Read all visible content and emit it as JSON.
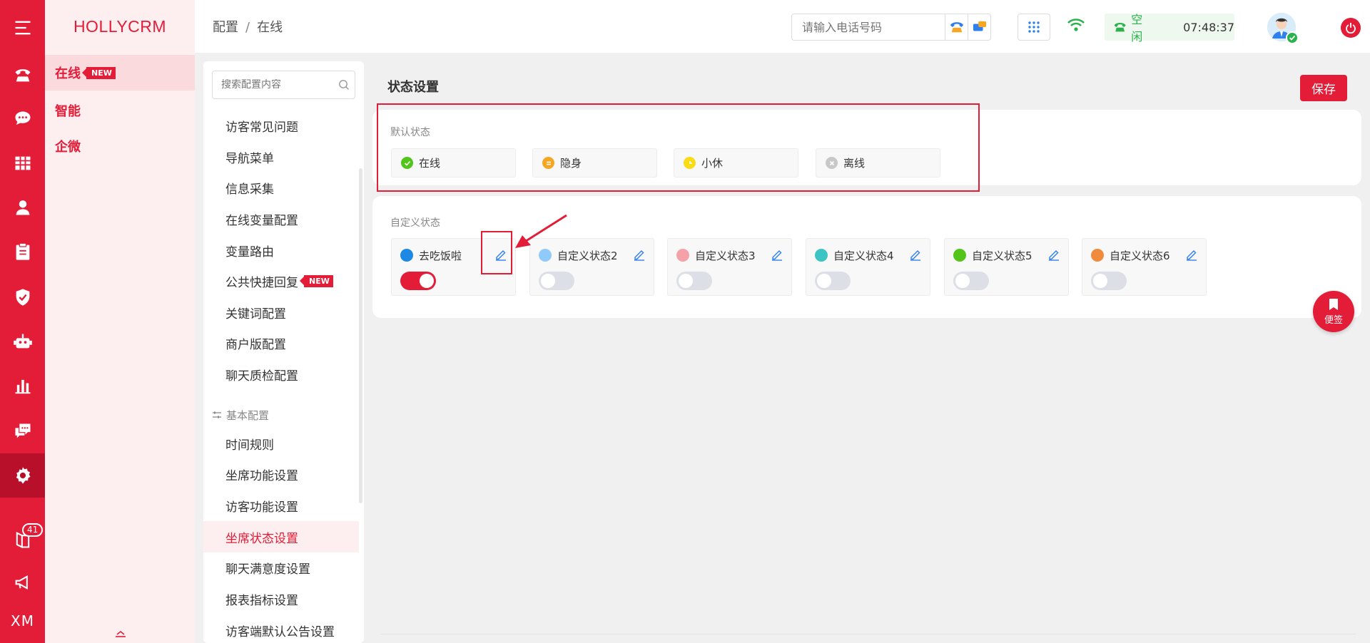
{
  "app": {
    "brand": "HOLLYCRM"
  },
  "rail": {
    "items": [
      {
        "icon": "menu-icon"
      },
      {
        "icon": "phone-icon"
      },
      {
        "icon": "chat-icon"
      },
      {
        "icon": "grid-icon"
      },
      {
        "icon": "user-icon"
      },
      {
        "icon": "clipboard-icon"
      },
      {
        "icon": "shield-check-icon"
      },
      {
        "icon": "robot-icon"
      },
      {
        "icon": "bar-chart-icon"
      },
      {
        "icon": "message-dots-icon"
      },
      {
        "icon": "gear-icon",
        "active": true
      },
      {
        "icon": "book-icon",
        "badge": "41"
      },
      {
        "icon": "megaphone-icon"
      },
      {
        "icon": "xm-text",
        "text": "XM"
      }
    ]
  },
  "col2": {
    "items": [
      {
        "label": "在线",
        "tag": "NEW",
        "active": true
      },
      {
        "label": "智能"
      },
      {
        "label": "企微"
      }
    ]
  },
  "topbar": {
    "breadcrumb": [
      "配置",
      "在线"
    ],
    "phone_placeholder": "请输入电话号码",
    "status": "空闲",
    "clock": "07:48:37"
  },
  "config_menu": {
    "search_placeholder": "搜索配置内容",
    "items": [
      {
        "label": "访客常见问题"
      },
      {
        "label": "导航菜单"
      },
      {
        "label": "信息采集"
      },
      {
        "label": "在线变量配置"
      },
      {
        "label": "变量路由"
      },
      {
        "label": "公共快捷回复",
        "tag": "NEW"
      },
      {
        "label": "关键词配置"
      },
      {
        "label": "商户版配置"
      },
      {
        "label": "聊天质检配置"
      }
    ],
    "group_title": "基本配置",
    "group_items": [
      {
        "label": "时间规则"
      },
      {
        "label": "坐席功能设置"
      },
      {
        "label": "访客功能设置"
      },
      {
        "label": "坐席状态设置",
        "active": true
      },
      {
        "label": "聊天满意度设置"
      },
      {
        "label": "报表指标设置"
      },
      {
        "label": "访客端默认公告设置"
      }
    ]
  },
  "main": {
    "title": "状态设置",
    "save_label": "保存",
    "default_label": "默认状态",
    "default_states": [
      {
        "label": "在线",
        "color": "#52c41a",
        "icon": "check-icon"
      },
      {
        "label": "隐身",
        "color": "#f5a623",
        "icon": "equals-icon"
      },
      {
        "label": "小休",
        "color": "#fadb14",
        "icon": "clock-icon"
      },
      {
        "label": "离线",
        "color": "#c8c8c8",
        "icon": "close-icon"
      }
    ],
    "custom_label": "自定义状态",
    "custom_states": [
      {
        "label": "去吃饭啦",
        "color": "#1e88e5",
        "enabled": true
      },
      {
        "label": "自定义状态2",
        "color": "#90caf9",
        "enabled": false
      },
      {
        "label": "自定义状态3",
        "color": "#f4a1a8",
        "enabled": false
      },
      {
        "label": "自定义状态4",
        "color": "#3cc3c3",
        "enabled": false
      },
      {
        "label": "自定义状态5",
        "color": "#52c41a",
        "enabled": false
      },
      {
        "label": "自定义状态6",
        "color": "#f08a3c",
        "enabled": false
      }
    ],
    "memo_label": "便签"
  },
  "colors": {
    "accent": "#e31c37",
    "idle_green": "#2bb24c"
  }
}
